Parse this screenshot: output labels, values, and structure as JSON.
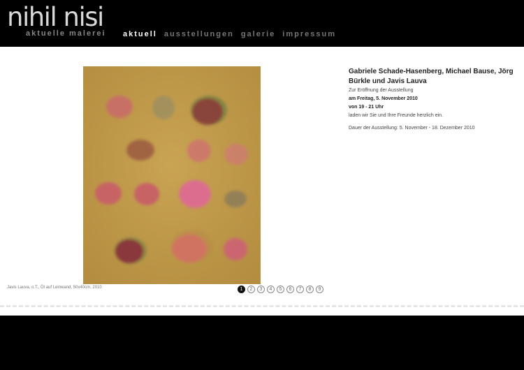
{
  "logo": {
    "title": "nihil nisi",
    "subtitle": "aktuelle malerei"
  },
  "nav": [
    "aktuell",
    "ausstellungen",
    "galerie",
    "impressum"
  ],
  "artwork": {
    "caption": "Javis Lauva, o.T., Öl auf Leinwand, 50x40cm, 2010"
  },
  "pager": {
    "pages": [
      "1",
      "2",
      "3",
      "4",
      "5",
      "6",
      "7",
      "8",
      "9"
    ],
    "current": "1"
  },
  "info": {
    "title": "Gabriele Schade-Hasenberg, Michael Bause, Jörg Bürkle und Javis Lauva",
    "line1": "Zur Eröffnung der Ausstellung",
    "line2": "am Freitag, 5. November 2010",
    "line3": "von 19 - 21 Uhr",
    "line4": "laden wir Sie und Ihre Freunde herzlich ein.",
    "duration": "Dauer der Ausstellung: 5. November - 18. Dezember 2010"
  },
  "colors": {
    "header_bg": "#000000",
    "canvas": "#c29b4a",
    "nav_active": "#ffffff",
    "nav_inactive": "#777777"
  }
}
